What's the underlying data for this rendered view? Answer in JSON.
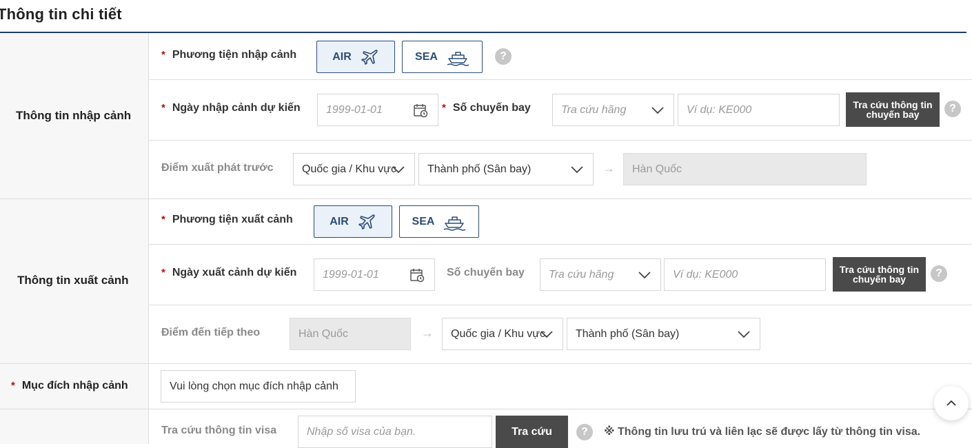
{
  "page": {
    "title": "Thông tin chi tiết"
  },
  "sections": {
    "entry": {
      "label": "Thông tin nhập cảnh",
      "transport_label": "Phương tiện nhập cảnh",
      "air_label": "AIR",
      "sea_label": "SEA",
      "date_label": "Ngày nhập cảnh dự kiến",
      "date_placeholder": "1999-01-01",
      "flight_label": "Số chuyến bay",
      "airline_placeholder": "Tra cứu hãng",
      "flight_placeholder": "Ví dụ: KE000",
      "lookup_label": "Tra cứu thông tin chuyến bay",
      "departure_label": "Điểm xuất phát trước",
      "country_select": "Quốc gia / Khu vực",
      "city_select": "Thành phố (Sân bay)",
      "destination_value": "Hàn Quốc"
    },
    "exit": {
      "label": "Thông tin xuất cảnh",
      "transport_label": "Phương tiện xuất cảnh",
      "air_label": "AIR",
      "sea_label": "SEA",
      "date_label": "Ngày xuất cảnh dự kiến",
      "date_placeholder": "1999-01-01",
      "flight_label": "Số chuyến bay",
      "airline_placeholder": "Tra cứu hãng",
      "flight_placeholder": "Ví dụ: KE000",
      "lookup_label": "Tra cứu thông tin chuyến bay",
      "next_label": "Điểm đến tiếp theo",
      "origin_value": "Hàn Quốc",
      "country_select": "Quốc gia / Khu vực",
      "city_select": "Thành phố (Sân bay)"
    },
    "purpose": {
      "label": "Mục đích nhập cảnh",
      "select_placeholder": "Vui lòng chọn mục đích nhập cảnh"
    },
    "visa": {
      "label": "Tra cứu thông tin visa",
      "input_placeholder": "Nhập số visa của bạn.",
      "button_label": "Tra cứu",
      "note": "※ Thông tin lưu trú và liên lạc sẽ được lấy từ thông tin visa."
    }
  },
  "symbols": {
    "required": "*",
    "help": "?",
    "arrow": "→"
  },
  "icons": [
    "airplane-icon",
    "ship-icon",
    "calendar-icon",
    "chevron-down-icon",
    "help-icon",
    "chevron-up-icon"
  ],
  "colors": {
    "accent": "#2c4d74",
    "dark_button": "#4a4a4a",
    "required": "#b01010"
  }
}
